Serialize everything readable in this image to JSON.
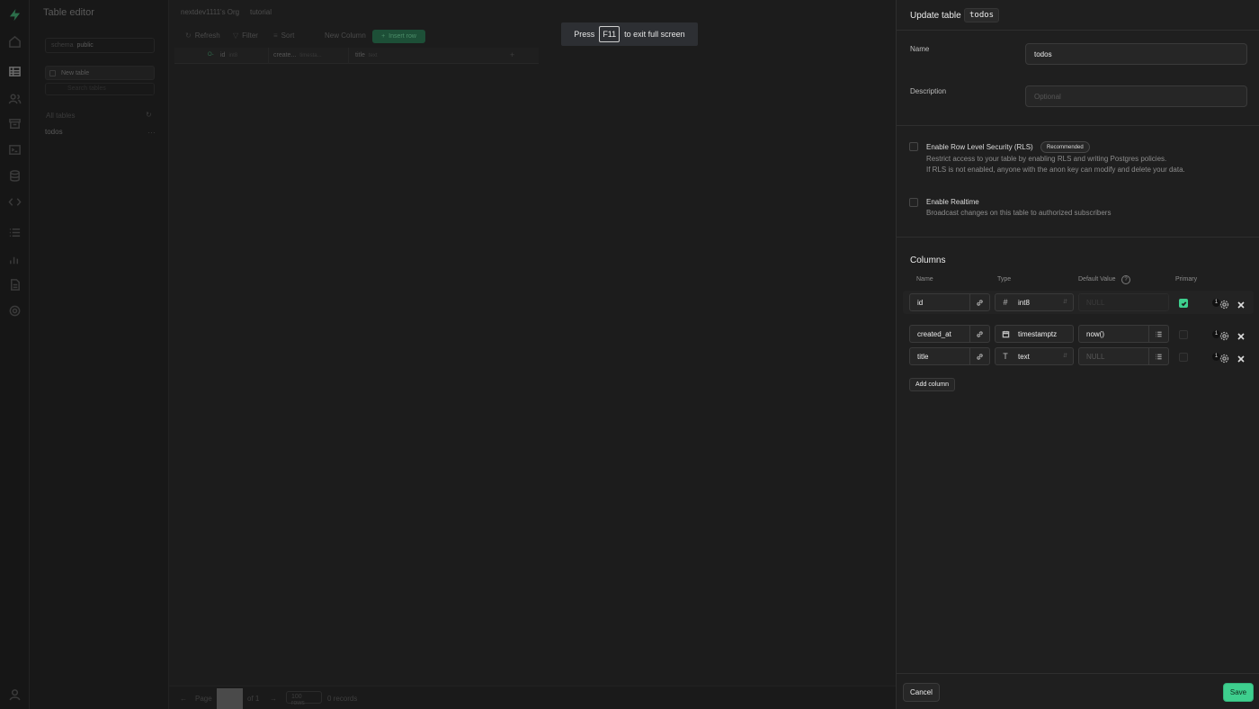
{
  "rail": {
    "icons": [
      "supabase-logo-icon",
      "home-icon",
      "table-editor-icon",
      "auth-icon",
      "storage-icon",
      "sql-editor-icon",
      "database-icon",
      "edge-functions-icon",
      "logs-icon",
      "reports-icon",
      "api-docs-icon",
      "settings-icon",
      "user-icon"
    ]
  },
  "sidebar": {
    "title": "Table editor",
    "schema_label": "schema",
    "schema_value": "public",
    "new_table": "New table",
    "search_placeholder": "Search tables",
    "all_tables": "All tables",
    "items": [
      {
        "label": "todos"
      }
    ]
  },
  "breadcrumb": {
    "org": "nextdev1111's Org",
    "project": "tutorial"
  },
  "toolbar": {
    "refresh": "Refresh",
    "filter": "Filter",
    "sort": "Sort",
    "new_column": "New Column",
    "insert_row": "Insert row"
  },
  "grid": {
    "columns": [
      {
        "name": "id",
        "type": "int8"
      },
      {
        "name": "create...",
        "type": "timesta..."
      },
      {
        "name": "title",
        "type": "text"
      }
    ]
  },
  "pager": {
    "page_label": "Page",
    "of": "of 1",
    "rows": "100 rows",
    "records": "0 records"
  },
  "toast": {
    "press": "Press",
    "key": "F11",
    "rest": "to exit full screen"
  },
  "panel": {
    "title": "Update table",
    "table_name_tag": "todos",
    "name_label": "Name",
    "name_value": "todos",
    "description_label": "Description",
    "description_placeholder": "Optional",
    "rls_title": "Enable Row Level Security (RLS)",
    "rls_badge": "Recommended",
    "rls_desc_1": "Restrict access to your table by enabling RLS and writing Postgres policies.",
    "rls_desc_2": "If RLS is not enabled, anyone with the anon key can modify and delete your data.",
    "realtime_title": "Enable Realtime",
    "realtime_desc": "Broadcast changes on this table to authorized subscribers",
    "columns_title": "Columns",
    "col_headers": {
      "name": "Name",
      "type": "Type",
      "default": "Default Value",
      "primary": "Primary"
    },
    "columns": [
      {
        "name": "id",
        "type": "int8",
        "type_icon": "hash-icon",
        "default": "",
        "default_placeholder": "NULL",
        "primary": true,
        "count": "1"
      },
      {
        "name": "created_at",
        "type": "timestamptz",
        "type_icon": "calendar-icon",
        "default": "now()",
        "default_placeholder": "",
        "primary": false,
        "count": "1"
      },
      {
        "name": "title",
        "type": "text",
        "type_icon": "text-type-icon",
        "default": "",
        "default_placeholder": "NULL",
        "primary": false,
        "count": "1"
      }
    ],
    "add_column": "Add column",
    "cancel": "Cancel",
    "save": "Save",
    "accent": "#3ecf8e"
  }
}
